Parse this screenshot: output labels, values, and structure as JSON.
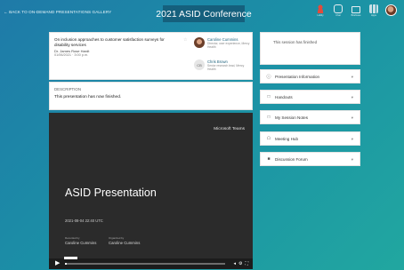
{
  "header": {
    "back_link": "← BACK TO ON-DEMAND PRESENTATIONS GALLERY",
    "conference_title": "2021 ASID Conference",
    "icons": [
      {
        "name": "user-icon",
        "label": "Lobby",
        "color": "#e24b3c"
      },
      {
        "name": "chat-icon",
        "label": "Chat",
        "color": "#e8eef2"
      },
      {
        "name": "briefcase-icon",
        "label": "Briefcase",
        "color": "#e8eef2"
      },
      {
        "name": "apps-icon",
        "label": "Apps",
        "color": "#e8eef2"
      }
    ]
  },
  "presentation": {
    "title": "On inclusion approaches to customer satisfaction surveys for disability services",
    "authors": "Dr. James Rose Hardt",
    "date": "01/06/2021 · 3:00 p.m.",
    "people": [
      {
        "name": "Caroline Cummins",
        "role": "Director, user experience, Mercy Health"
      },
      {
        "name": "Chris Brown",
        "role": "Senior research lead, Mercy Health"
      }
    ]
  },
  "description": {
    "heading": "DESCRIPTION",
    "text": "This presentation has now finished."
  },
  "video": {
    "brand": "Microsoft Teams",
    "title": "ASID Presentation",
    "date": "2021-08-04 22:40 UTC",
    "speakers": [
      {
        "label": "Recorded by",
        "name": "Caroline Cummins"
      },
      {
        "label": "Organized by",
        "name": "Caroline Cummins"
      }
    ],
    "progress_fraction": 0.01
  },
  "sidebar": {
    "card_text": "This session has finished",
    "items": [
      {
        "icon": "info-icon",
        "glyph": "ⓘ",
        "label": "Presentation Information"
      },
      {
        "icon": "handout-icon",
        "glyph": "□",
        "label": "Handouts"
      },
      {
        "icon": "notes-icon",
        "glyph": "□",
        "label": "My Session Notes"
      },
      {
        "icon": "meeting-hub-icon",
        "glyph": "☖",
        "label": "Meeting Hub"
      },
      {
        "icon": "discussion-icon",
        "glyph": "■",
        "label": "Discussion Forum"
      }
    ]
  }
}
